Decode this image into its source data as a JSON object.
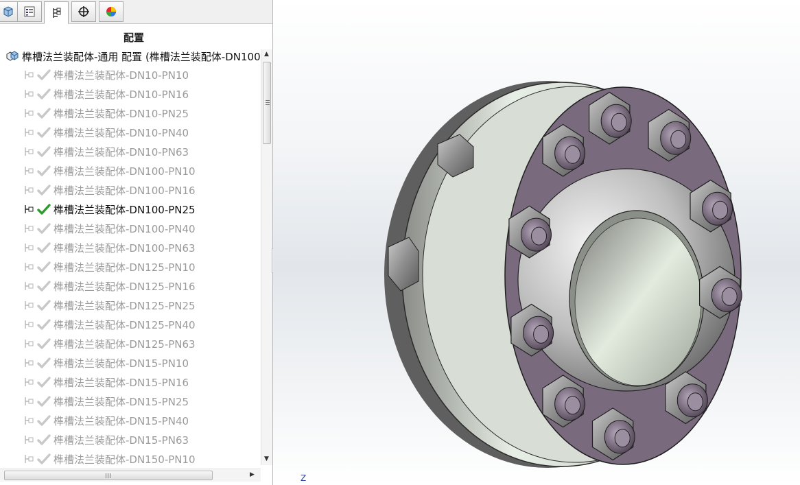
{
  "panel": {
    "tabs": [
      {
        "name": "feature-manager-tab",
        "icon": "part-icon"
      },
      {
        "name": "property-manager-tab",
        "icon": "property-list-icon"
      },
      {
        "name": "configuration-manager-tab",
        "icon": "configuration-icon",
        "active": true
      },
      {
        "name": "dimxpert-tab",
        "icon": "crosshair-icon"
      },
      {
        "name": "display-manager-tab",
        "icon": "color-wheel-icon"
      }
    ],
    "title": "配置",
    "root_label": "榫槽法兰装配体-通用 配置  (榫槽法兰装配体-DN100",
    "active_index": 7,
    "items": [
      "榫槽法兰装配体-DN10-PN10",
      "榫槽法兰装配体-DN10-PN16",
      "榫槽法兰装配体-DN10-PN25",
      "榫槽法兰装配体-DN10-PN40",
      "榫槽法兰装配体-DN10-PN63",
      "榫槽法兰装配体-DN100-PN10",
      "榫槽法兰装配体-DN100-PN16",
      "榫槽法兰装配体-DN100-PN25",
      "榫槽法兰装配体-DN100-PN40",
      "榫槽法兰装配体-DN100-PN63",
      "榫槽法兰装配体-DN125-PN10",
      "榫槽法兰装配体-DN125-PN16",
      "榫槽法兰装配体-DN125-PN25",
      "榫槽法兰装配体-DN125-PN40",
      "榫槽法兰装配体-DN125-PN63",
      "榫槽法兰装配体-DN15-PN10",
      "榫槽法兰装配体-DN15-PN16",
      "榫槽法兰装配体-DN15-PN25",
      "榫槽法兰装配体-DN15-PN40",
      "榫槽法兰装配体-DN15-PN63",
      "榫槽法兰装配体-DN150-PN10"
    ]
  },
  "viewport": {
    "triad_label": "Z"
  },
  "colors": {
    "flange_face": "#7a6a7e",
    "active_check": "#2e9a2e",
    "inactive_check": "#c8c8c8"
  }
}
